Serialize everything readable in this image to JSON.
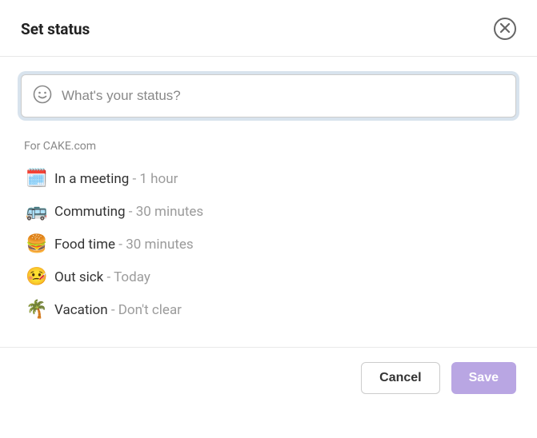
{
  "header": {
    "title": "Set status"
  },
  "input": {
    "placeholder": "What's your status?",
    "value": ""
  },
  "context_label": "For CAKE.com",
  "presets": [
    {
      "emoji": "🗓️",
      "label": "In a meeting",
      "duration": "1 hour"
    },
    {
      "emoji": "🚌",
      "label": "Commuting",
      "duration": "30 minutes"
    },
    {
      "emoji": "🍔",
      "label": "Food time",
      "duration": "30 minutes"
    },
    {
      "emoji": "🤒",
      "label": "Out sick",
      "duration": "Today"
    },
    {
      "emoji": "🌴",
      "label": "Vacation",
      "duration": "Don't clear"
    }
  ],
  "footer": {
    "cancel": "Cancel",
    "save": "Save"
  }
}
